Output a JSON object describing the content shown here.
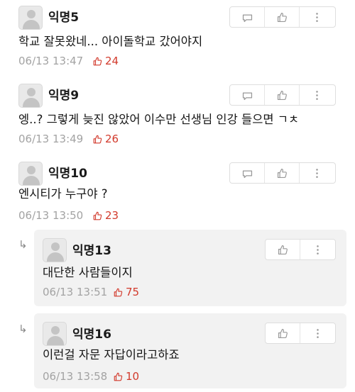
{
  "comments": [
    {
      "author": "익명5",
      "text": "학교 잘못왔네... 아이돌학교 갔어야지",
      "time": "06/13 13:47",
      "likes": "24"
    },
    {
      "author": "익명9",
      "text": "엥..? 그렇게 늦진 않았어 이수만 선생님 인강 들으면 ㄱㅊ",
      "time": "06/13 13:49",
      "likes": "26"
    },
    {
      "author": "익명10",
      "text": "엔시티가 누구야 ?",
      "time": "06/13 13:50",
      "likes": "23"
    }
  ],
  "replies": [
    {
      "author": "익명13",
      "text": "대단한 사람들이지",
      "time": "06/13 13:51",
      "likes": "75"
    },
    {
      "author": "익명16",
      "text": "이런걸 자문 자답이라고하죠",
      "time": "06/13 13:58",
      "likes": "10"
    }
  ],
  "icons": {
    "reply": "speech-bubble-icon",
    "like": "thumbs-up-icon",
    "more": "vertical-dots-icon",
    "reply_marker": "reply-arrow-icon"
  },
  "colors": {
    "like_count": "#d23a2c",
    "meta": "#a3a3a3",
    "reply_background": "#f2f2f2"
  }
}
